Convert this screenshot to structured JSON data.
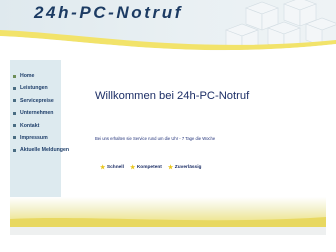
{
  "header": {
    "logo_text": "24h-PC-Notruf"
  },
  "nav": {
    "items": [
      {
        "label": "Home",
        "active": true
      },
      {
        "label": "Leistungen",
        "active": false
      },
      {
        "label": "Servicepreise",
        "active": false
      },
      {
        "label": "Unternehmen",
        "active": false
      },
      {
        "label": "Kontakt",
        "active": false
      },
      {
        "label": "Impressum",
        "active": false
      },
      {
        "label": "Aktuelle Meldungen",
        "active": false
      }
    ]
  },
  "main": {
    "title": "Willkommen bei 24h-PC-Notruf",
    "subtitle": "Bei uns erhalten sie Service rund um die Uhr - 7 Tage die Woche",
    "features": [
      "Schnell",
      "Kompetent",
      "Zuverlässig"
    ]
  },
  "colors": {
    "accent_yellow": "#f2e36a",
    "nav_text": "#1f3f6a",
    "title_text": "#1c2e66",
    "sidebar_bg": "#ddeaef"
  }
}
